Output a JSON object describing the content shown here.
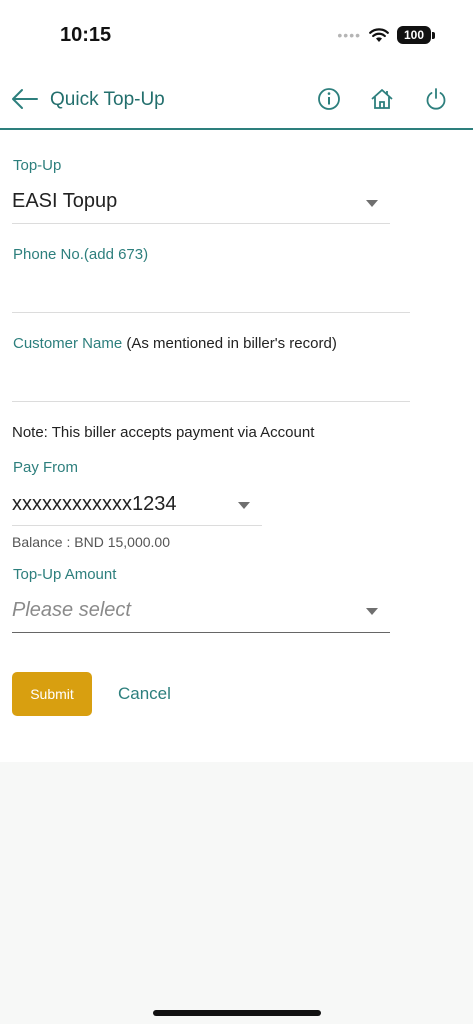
{
  "status_bar": {
    "time": "10:15",
    "signal_dots": "••••",
    "battery": "100"
  },
  "header": {
    "title": "Quick Top-Up"
  },
  "icons": {
    "back": "arrow-left-icon",
    "info": "info-icon",
    "home": "home-icon",
    "power": "power-icon"
  },
  "form": {
    "topup_label": "Top-Up",
    "topup_value": "EASI Topup",
    "phone_label": "Phone No.(add 673)",
    "phone_value": "",
    "customer_label": "Customer Name",
    "customer_hint": " (As mentioned in biller's record)",
    "customer_value": "",
    "note": "Note: This biller accepts payment via Account",
    "pay_from_label": "Pay From",
    "pay_from_value": "xxxxxxxxxxxx1234",
    "balance": "Balance : BND 15,000.00",
    "amount_label": "Top-Up Amount",
    "amount_placeholder": "Please select"
  },
  "actions": {
    "submit": "Submit",
    "cancel": "Cancel"
  },
  "colors": {
    "accent": "#2d7f7d",
    "submit": "#d89f10"
  }
}
